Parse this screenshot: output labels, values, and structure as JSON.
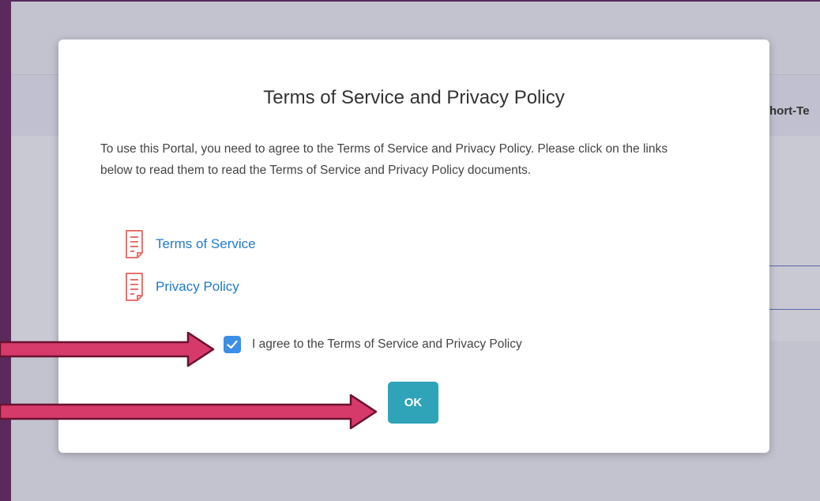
{
  "background": {
    "column_header": "hort-Te"
  },
  "modal": {
    "title": "Terms of Service and Privacy Policy",
    "description": "To use this Portal, you need to agree to the Terms of Service and Privacy Policy. Please click on the links below to read them to read the Terms of Service and Privacy Policy documents.",
    "links": [
      {
        "label": "Terms of Service",
        "icon": "document-icon"
      },
      {
        "label": "Privacy Policy",
        "icon": "document-icon"
      }
    ],
    "agree_label": "I agree to the Terms of Service and Privacy Policy",
    "agree_checked": true,
    "ok_label": "OK"
  },
  "colors": {
    "overlay_frame": "#5a2a5c",
    "link": "#1f7acf",
    "checkbox": "#3d8ee6",
    "ok_button": "#2fa3b8",
    "doc_icon": "#e8736d",
    "arrow": "#d63a6a"
  }
}
